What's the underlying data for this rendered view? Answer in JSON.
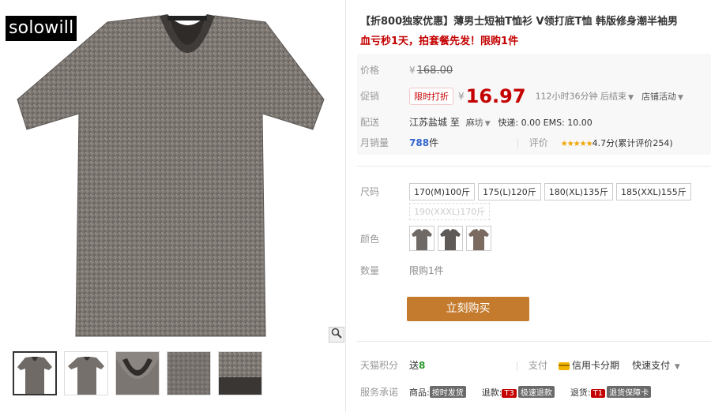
{
  "gallery": {
    "brand": "solowill",
    "zoom_icon": "magnifier-icon",
    "thumbnails": [
      {
        "name": "front-view"
      },
      {
        "name": "side-view"
      },
      {
        "name": "collar-detail"
      },
      {
        "name": "fabric-detail"
      },
      {
        "name": "hem-detail"
      }
    ]
  },
  "product": {
    "title": "【折800独家优惠】薄男士短袖T恤衫 V领打底T恤 韩版修身潮半袖男",
    "promo": "血亏秒1天，拍套餐先发！限购1件"
  },
  "pricing": {
    "price_label": "价格",
    "original_currency": "¥",
    "original_price": "168.00",
    "promo_label": "促销",
    "promo_badge": "限时打折",
    "currency": "¥",
    "current_price": "16.97",
    "countdown": "112小时36分钟 后结束",
    "store_promo": "店铺活动"
  },
  "shipping": {
    "label": "配送",
    "from": "江苏盐城",
    "to_word": "至",
    "to": "麻坊",
    "express": "快递: 0.00 EMS: 10.00"
  },
  "sales": {
    "label": "月销量",
    "count": "788",
    "unit": "件",
    "rating_label": "评价",
    "stars": "★★★★★",
    "rating": "4.7分(累计评价254)"
  },
  "options": {
    "size_label": "尺码",
    "sizes": [
      "170(M)100斤",
      "175(L)120斤",
      "180(XL)135斤",
      "185(XXL)155斤"
    ],
    "size_disabled": "190(XXXL)170斤",
    "color_label": "颜色",
    "quantity_label": "数量",
    "quantity_limit": "限购1件",
    "buy_button": "立刻购买"
  },
  "footer": {
    "points_label": "天猫积分",
    "points_prefix": "送",
    "points": "8",
    "pay_label": "支付",
    "credit": "信用卡分期",
    "quick_pay": "快速支付",
    "service_label": "服务承诺",
    "goods_prefix": "商品:",
    "goods_badge": "按时发货",
    "refund_prefix": "退款:",
    "refund_t3": "T3",
    "refund_text": "极速退款",
    "return_prefix": "退货:",
    "return_t1": "T1",
    "return_text": "退货保障卡"
  },
  "colors": {
    "accent": "#c40000",
    "buy_button": "#c47b2e",
    "shirt": "#6f6a66"
  }
}
